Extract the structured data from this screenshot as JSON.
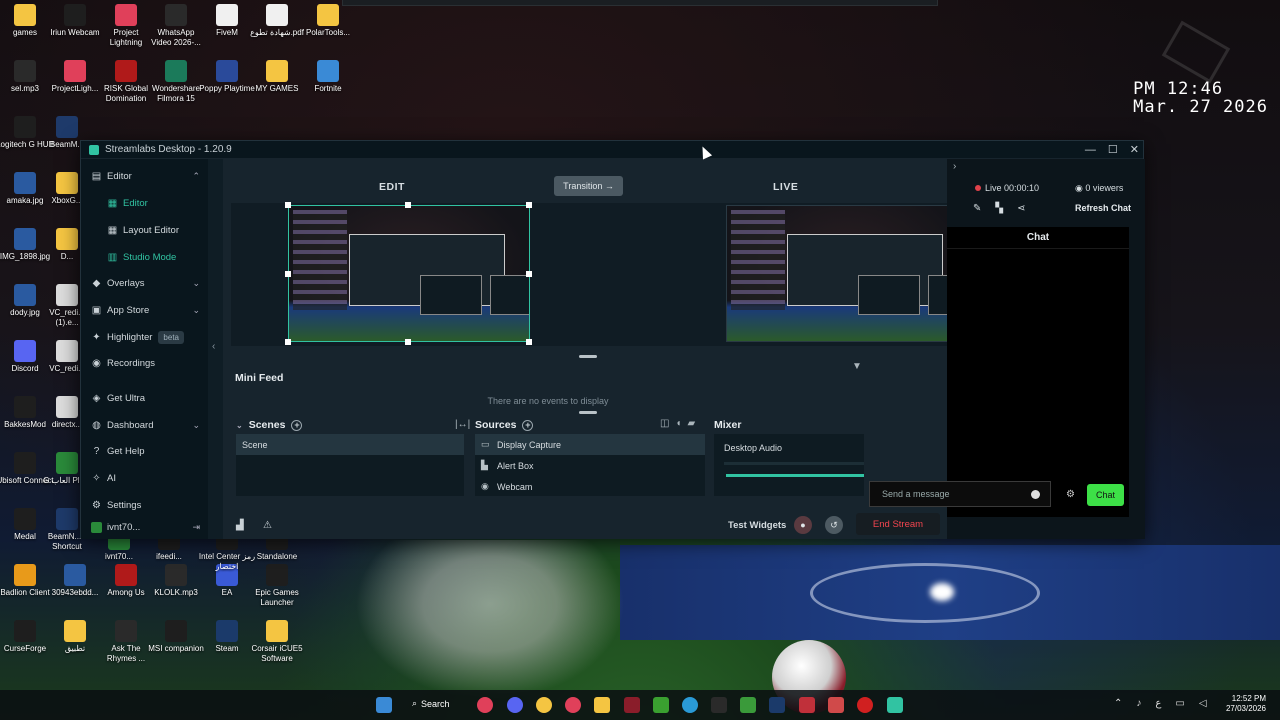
{
  "desktop": {
    "clock_time": "PM 12:46",
    "clock_date": "Mar. 27 2026",
    "icons": [
      {
        "label": "games",
        "color": "#f4c542"
      },
      {
        "label": "Iriun Webcam",
        "color": "#1e1e1e"
      },
      {
        "label": "Project Lightning",
        "color": "#e0405a"
      },
      {
        "label": "WhatsApp Video 2026-...",
        "color": "#2a2a2a"
      },
      {
        "label": "FiveM",
        "color": "#f0f0f0"
      },
      {
        "label": "شهادة تطوع.pdf",
        "color": "#f0f0f0"
      },
      {
        "label": "PolarTools...",
        "color": "#f4c542"
      },
      {
        "label": "sel.mp3",
        "color": "#2a2a2a"
      },
      {
        "label": "ProjectLigh...",
        "color": "#e0405a"
      },
      {
        "label": "RISK Global Domination",
        "color": "#b01a1a"
      },
      {
        "label": "Wondershare Filmora 15",
        "color": "#1b7a5a"
      },
      {
        "label": "Poppy Playtime",
        "color": "#2a4a9a"
      },
      {
        "label": "MY GAMES",
        "color": "#f4c542"
      },
      {
        "label": "Fortnite",
        "color": "#3a8ad6"
      },
      {
        "label": "Logitech G HUB",
        "color": "#1e1e1e"
      },
      {
        "label": "BeamM...",
        "color": "#1e3a6a"
      },
      {
        "label": "amaka.jpg",
        "color": "#2a5aa0"
      },
      {
        "label": "XboxG...",
        "color": "#f4c542"
      },
      {
        "label": "IMG_1898.jpg",
        "color": "#2a5aa0"
      },
      {
        "label": "D...",
        "color": "#f4c542"
      },
      {
        "label": "dody.jpg",
        "color": "#2a5aa0"
      },
      {
        "label": "VC_redi... (1).e...",
        "color": "#dcdcdc"
      },
      {
        "label": "Discord",
        "color": "#5865f2"
      },
      {
        "label": "VC_redi...",
        "color": "#dcdcdc"
      },
      {
        "label": "BakkesMod",
        "color": "#1e1e1e"
      },
      {
        "label": "directx...",
        "color": "#dcdcdc"
      },
      {
        "label": "Ubisoft Connect",
        "color": "#1e1e1e"
      },
      {
        "label": "G العاب Pla...",
        "color": "#2a8a3a"
      },
      {
        "label": "Medal",
        "color": "#1e1e1e"
      },
      {
        "label": "BeamN... - Shortcut",
        "color": "#1e3a6a"
      },
      {
        "label": "Badlion Client",
        "color": "#e89a1a"
      },
      {
        "label": "30943ebdd...",
        "color": "#2a5aa0"
      },
      {
        "label": "Among Us",
        "color": "#b01a1a"
      },
      {
        "label": "KLOLK.mp3",
        "color": "#2a2a2a"
      },
      {
        "label": "EA",
        "color": "#3a5ad6"
      },
      {
        "label": "Epic Games Launcher",
        "color": "#1e1e1e"
      },
      {
        "label": "CurseForge",
        "color": "#1e1e1e"
      },
      {
        "label": "تطبيق",
        "color": "#f4c542"
      },
      {
        "label": "Ask The Rhymes ...",
        "color": "#2a2a2a"
      },
      {
        "label": "MSI companion",
        "color": "#1e1e1e"
      },
      {
        "label": "Steam",
        "color": "#1b3a6a"
      },
      {
        "label": "Corsair iCUE5 Software",
        "color": "#f4c542"
      },
      {
        "label": "ivnt70...",
        "color": "#2a8a3a"
      },
      {
        "label": "ifeedi...",
        "color": "#1e1e1e"
      },
      {
        "label": "Intel Center رمز اختصار",
        "color": "#1e1e1e"
      },
      {
        "label": "Standalone",
        "color": "#1e1e1e"
      }
    ]
  },
  "window": {
    "title": "Streamlabs Desktop - 1.20.9",
    "controls": [
      "—",
      "☐",
      "✕"
    ]
  },
  "sidebar": {
    "editor": "Editor",
    "editor_sub": "Editor",
    "layout_editor": "Layout Editor",
    "studio_mode": "Studio Mode",
    "overlays": "Overlays",
    "app_store": "App Store",
    "highlighter": "Highlighter",
    "beta": "beta",
    "recordings": "Recordings",
    "get_ultra": "Get Ultra",
    "dashboard": "Dashboard",
    "get_help": "Get Help",
    "ai": "AI",
    "settings": "Settings",
    "user": "ivnt70..."
  },
  "studio": {
    "edit_label": "EDIT",
    "live_label": "LIVE",
    "transition": "Transition →",
    "minifeed_title": "Mini Feed",
    "minifeed_empty": "There are no events to display",
    "scenes_title": "Scenes",
    "scenes": [
      "Scene"
    ],
    "sources_title": "Sources",
    "sources": [
      {
        "icon": "▭",
        "label": "Display Capture"
      },
      {
        "icon": "▙",
        "label": "Alert Box"
      },
      {
        "icon": "◉",
        "label": "Webcam"
      }
    ],
    "mixer_title": "Mixer",
    "mixer_source": "Desktop Audio",
    "test_widgets": "Test Widgets",
    "end_stream": "End Stream"
  },
  "right_panel": {
    "live_time": "Live 00:00:10",
    "viewers": "0 viewers",
    "refresh_chat": "Refresh Chat",
    "chat_title": "Chat",
    "message_placeholder": "Send a message",
    "chat_button": "Chat"
  },
  "taskbar": {
    "search": "Search",
    "time": "12:52 PM",
    "date": "27/03/2026",
    "lang": "ع"
  }
}
